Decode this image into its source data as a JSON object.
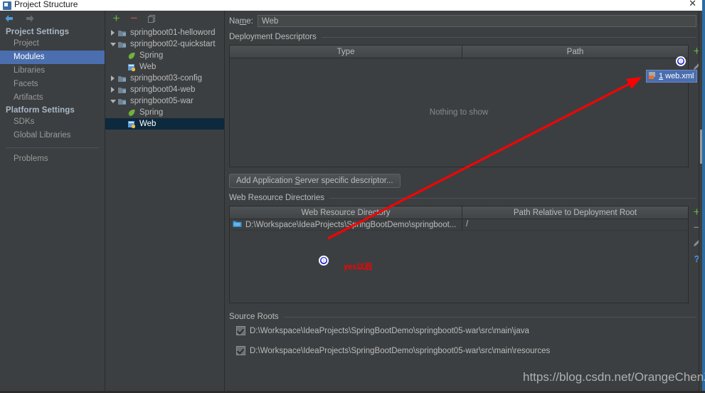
{
  "window": {
    "title": "Project Structure",
    "close_label": "✕"
  },
  "sidebar": {
    "back_icon": "arrow-left-icon",
    "forward_icon": "arrow-right-icon",
    "groups": [
      {
        "label": "Project Settings",
        "items": [
          {
            "label": "Project",
            "selected": false
          },
          {
            "label": "Modules",
            "selected": true
          },
          {
            "label": "Libraries",
            "selected": false
          },
          {
            "label": "Facets",
            "selected": false
          },
          {
            "label": "Artifacts",
            "selected": false
          }
        ]
      },
      {
        "label": "Platform Settings",
        "items": [
          {
            "label": "SDKs",
            "selected": false
          },
          {
            "label": "Global Libraries",
            "selected": false
          }
        ]
      }
    ],
    "problems_label": "Problems"
  },
  "tree": {
    "toolbar": {
      "add_label": "+",
      "remove_label": "−",
      "copy_icon": "copy-icon"
    },
    "nodes": [
      {
        "label": "springboot01-helloword",
        "twisty": "right",
        "icon": "module-icon",
        "depth": 0,
        "selected": false
      },
      {
        "label": "springboot02-quickstart",
        "twisty": "down",
        "icon": "module-icon",
        "depth": 0,
        "selected": false
      },
      {
        "label": "Spring",
        "twisty": "none",
        "icon": "spring-icon",
        "depth": 1,
        "selected": false
      },
      {
        "label": "Web",
        "twisty": "none",
        "icon": "web-icon",
        "depth": 1,
        "selected": false
      },
      {
        "label": "springboot03-config",
        "twisty": "right",
        "icon": "module-icon",
        "depth": 0,
        "selected": false
      },
      {
        "label": "springboot04-web",
        "twisty": "right",
        "icon": "module-icon",
        "depth": 0,
        "selected": false
      },
      {
        "label": "springboot05-war",
        "twisty": "down",
        "icon": "module-icon",
        "depth": 0,
        "selected": false
      },
      {
        "label": "Spring",
        "twisty": "none",
        "icon": "spring-icon",
        "depth": 1,
        "selected": false
      },
      {
        "label": "Web",
        "twisty": "none",
        "icon": "web-icon",
        "depth": 1,
        "selected": true
      }
    ]
  },
  "facet": {
    "name_label_pre": "Na",
    "name_label_mnemonic": "m",
    "name_label_post": "e:",
    "name_value": "Web",
    "deployment": {
      "section_label": "Deployment Descriptors",
      "columns": [
        "Type",
        "Path"
      ],
      "empty_text": "Nothing to show",
      "add_label": "+",
      "edit_icon": "pencil-icon"
    },
    "add_descriptor_button": {
      "pre": "Add Application ",
      "mnemonic": "S",
      "post": "erver specific descriptor..."
    },
    "web_resources": {
      "section_label": "Web Resource Directories",
      "columns": [
        "Web Resource Directory",
        "Path Relative to Deployment Root"
      ],
      "rows": [
        {
          "directory": "D:\\Workspace\\IdeaProjects\\SpringBootDemo\\springboot...",
          "relative_path": "/"
        }
      ],
      "add_label": "+",
      "remove_label": "−",
      "edit_icon": "pencil-icon",
      "help_label": "?"
    },
    "source_roots": {
      "section_label": "Source Roots",
      "rows": [
        {
          "path": "D:\\Workspace\\IdeaProjects\\SpringBootDemo\\springboot05-war\\src\\main\\java",
          "checked": true
        },
        {
          "path": "D:\\Workspace\\IdeaProjects\\SpringBootDemo\\springboot05-war\\src\\main\\resources",
          "checked": true
        }
      ]
    }
  },
  "popup": {
    "web_xml_count": "1",
    "web_xml_label": "web.xml",
    "icon": "xml-file-icon"
  },
  "annotations": {
    "marker_one": "❶",
    "marker_two": "❷",
    "red_note": "yes以后",
    "arrow_color": "#ff0000"
  },
  "watermark": {
    "text": "https://blog.csdn.net/OrangeChenZ"
  },
  "colors": {
    "background": "#3c3f41",
    "selection_blue": "#4b6eaf",
    "tree_selection": "#0d293e",
    "text": "#bbbbbb",
    "accent_green": "#62b543",
    "accent_red": "#c75450",
    "annotation_red": "#ff0000",
    "annotation_blue": "#1414cf"
  }
}
